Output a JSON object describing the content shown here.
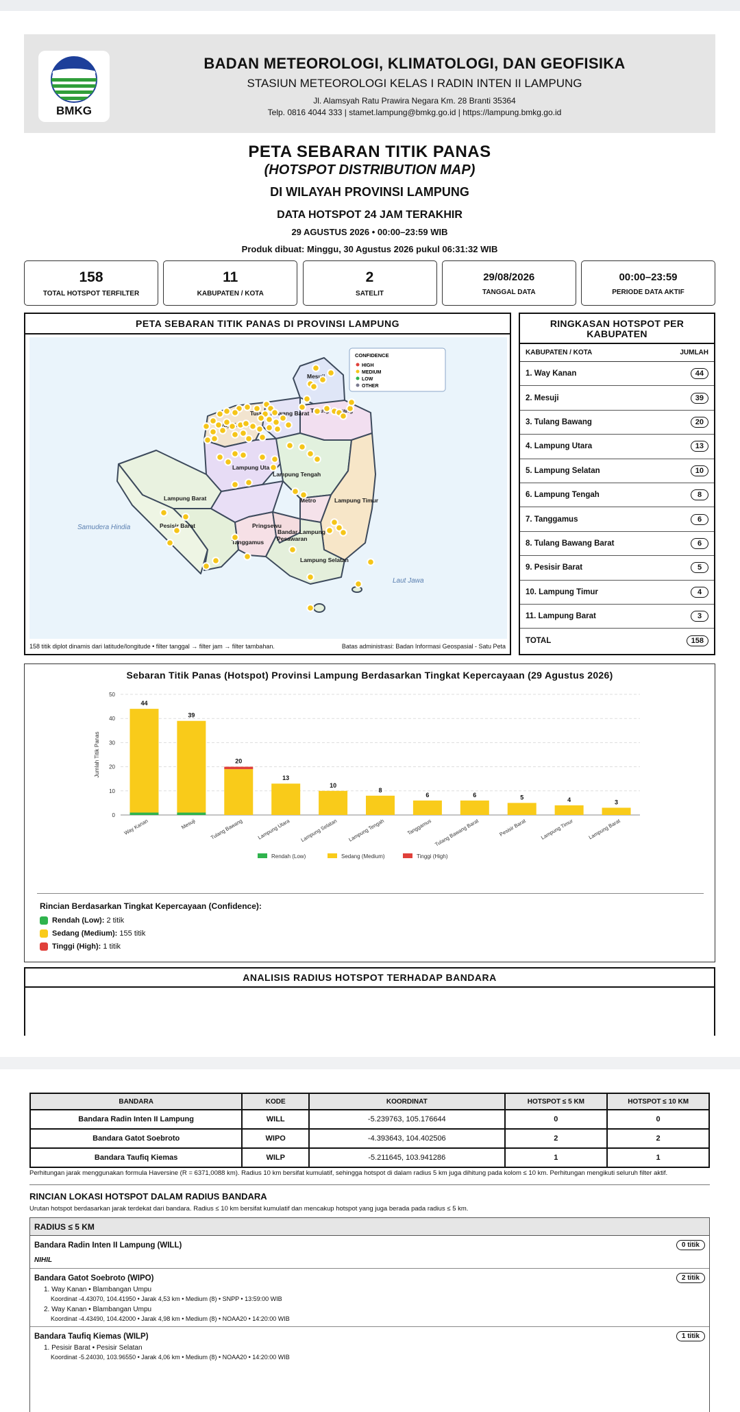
{
  "header": {
    "logo_text": "BMKG",
    "agency": "BADAN METEOROLOGI, KLIMATOLOGI, DAN GEOFISIKA",
    "station": "STASIUN METEOROLOGI KELAS I RADIN INTEN II LAMPUNG",
    "address": "Jl. Alamsyah Ratu Prawira Negara Km. 28 Branti 35364",
    "contact": "Telp. 0816 4044 333  |  stamet.lampung@bmkg.go.id  |  https://lampung.bmkg.go.id"
  },
  "title": {
    "main": "PETA SEBARAN TITIK PANAS",
    "english": "(HOTSPOT DISTRIBUTION MAP)",
    "region": "DI WILAYAH PROVINSI LAMPUNG",
    "data_label": "DATA HOTSPOT 24 JAM TERAKHIR",
    "date_range": "29 AGUSTUS 2026 • 00:00–23:59 WIB",
    "produced": "Produk dibuat: Minggu, 30 Agustus 2026 pukul 06:31:32 WIB"
  },
  "stats": [
    {
      "value": "158",
      "label": "TOTAL HOTSPOT TERFILTER"
    },
    {
      "value": "11",
      "label": "KABUPATEN / KOTA"
    },
    {
      "value": "2",
      "label": "SATELIT"
    },
    {
      "value": "29/08/2026",
      "label": "TANGGAL DATA"
    },
    {
      "value": "00:00–23:59",
      "label": "PERIODE DATA AKTIF"
    }
  ],
  "map": {
    "title": "PETA SEBARAN TITIK PANAS DI PROVINSI LAMPUNG",
    "legend": {
      "title": "CONFIDENCE",
      "items": [
        {
          "label": "HIGH",
          "color": "#e0403a"
        },
        {
          "label": "MEDIUM",
          "color": "#f5c518"
        },
        {
          "label": "LOW",
          "color": "#2fb34d"
        },
        {
          "label": "OTHER",
          "color": "#7a7a90"
        }
      ]
    },
    "labels": [
      "Mesuji",
      "Tulang Bawang Barat",
      "Tulang Bawang",
      "Way Kanan",
      "Lampung Utara",
      "Lampung Tengah",
      "Lampung Barat",
      "Metro",
      "Lampung Timur",
      "Pesisir Barat",
      "Pringsewu",
      "Bandar Lampung",
      "Pesawaran",
      "Tanggamus",
      "Lampung Selatan"
    ],
    "sea_labels": [
      "Samudera Hindia",
      "Laut Jawa"
    ],
    "footer_left": "158 titik diplot dinamis dari latitude/longitude • filter tanggal → filter jam → filter tambahan.",
    "footer_right": "Batas administrasi: Badan Informasi Geospasial - Satu Peta"
  },
  "summary": {
    "title": "RINGKASAN HOTSPOT PER KABUPATEN",
    "col_name": "KABUPATEN / KOTA",
    "col_count": "JUMLAH",
    "rows": [
      {
        "name": "1. Way Kanan",
        "count": "44"
      },
      {
        "name": "2. Mesuji",
        "count": "39"
      },
      {
        "name": "3. Tulang Bawang",
        "count": "20"
      },
      {
        "name": "4. Lampung Utara",
        "count": "13"
      },
      {
        "name": "5. Lampung Selatan",
        "count": "10"
      },
      {
        "name": "6. Lampung Tengah",
        "count": "8"
      },
      {
        "name": "7. Tanggamus",
        "count": "6"
      },
      {
        "name": "8. Tulang Bawang Barat",
        "count": "6"
      },
      {
        "name": "9. Pesisir Barat",
        "count": "5"
      },
      {
        "name": "10. Lampung Timur",
        "count": "4"
      },
      {
        "name": "11. Lampung Barat",
        "count": "3"
      }
    ],
    "total_label": "TOTAL",
    "total_value": "158"
  },
  "chart_data": {
    "type": "bar",
    "stacked": true,
    "title": "Sebaran Titik Panas (Hotspot) Provinsi Lampung Berdasarkan Tingkat Kepercayaan (29 Agustus 2026)",
    "ylabel": "Jumlah Titik Panas",
    "xlabel": "",
    "ylim": [
      0,
      50
    ],
    "yticks": [
      0,
      10,
      20,
      30,
      40,
      50
    ],
    "grid": true,
    "legend_position": "bottom",
    "categories": [
      "Way Kanan",
      "Mesuji",
      "Tulang Bawang",
      "Lampung Utara",
      "Lampung Selatan",
      "Lampung Tengah",
      "Tanggamus",
      "Tulang Bawang Barat",
      "Pesisir Barat",
      "Lampung Timur",
      "Lampung Barat"
    ],
    "series": [
      {
        "name": "Rendah (Low)",
        "color": "#2fb34d",
        "values": [
          1,
          1,
          0,
          0,
          0,
          0,
          0,
          0,
          0,
          0,
          0
        ]
      },
      {
        "name": "Sedang (Medium)",
        "color": "#f9cb1a",
        "values": [
          43,
          38,
          19,
          13,
          10,
          8,
          6,
          6,
          5,
          4,
          3
        ]
      },
      {
        "name": "Tinggi (High)",
        "color": "#e0403a",
        "values": [
          0,
          0,
          1,
          0,
          0,
          0,
          0,
          0,
          0,
          0,
          0
        ]
      }
    ],
    "totals": [
      44,
      39,
      20,
      13,
      10,
      8,
      6,
      6,
      5,
      4,
      3
    ]
  },
  "confidence": {
    "title": "Rincian Berdasarkan Tingkat Kepercayaan (Confidence):",
    "items": [
      {
        "label": "Rendah (Low):",
        "value": "2 titik",
        "color": "#2fb34d"
      },
      {
        "label": "Sedang (Medium):",
        "value": "155 titik",
        "color": "#f9cb1a"
      },
      {
        "label": "Tinggi (High):",
        "value": "1 titik",
        "color": "#e0403a"
      }
    ]
  },
  "radius": {
    "title": "ANALISIS RADIUS HOTSPOT TERHADAP BANDARA",
    "columns": [
      "BANDARA",
      "KODE",
      "KOORDINAT",
      "HOTSPOT ≤ 5 KM",
      "HOTSPOT ≤ 10 KM"
    ],
    "rows": [
      {
        "name": "Bandara Radin Inten II Lampung",
        "code": "WILL",
        "coord": "-5.239763, 105.176644",
        "r5": "0",
        "r10": "0"
      },
      {
        "name": "Bandara Gatot Soebroto",
        "code": "WIPO",
        "coord": "-4.393643, 104.402506",
        "r5": "2",
        "r10": "2"
      },
      {
        "name": "Bandara Taufiq Kiemas",
        "code": "WILP",
        "coord": "-5.211645, 103.941286",
        "r5": "1",
        "r10": "1"
      }
    ],
    "note": "Perhitungan jarak menggunakan formula Haversine (R = 6371,0088 km). Radius 10 km bersifat kumulatif, sehingga hotspot di dalam radius 5 km juga dihitung pada kolom ≤ 10 km. Perhitungan mengikuti seluruh filter aktif."
  },
  "details": {
    "title": "RINCIAN LOKASI HOTSPOT DALAM RADIUS BANDARA",
    "subtitle": "Urutan hotspot berdasarkan jarak terdekat dari bandara. Radius ≤ 10 km bersifat kumulatif dan mencakup hotspot yang juga berada pada radius ≤ 5 km.",
    "radius_head": "RADIUS ≤ 5 KM",
    "airports": [
      {
        "name": "Bandara Radin Inten II Lampung (WILL)",
        "badge": "0 titik",
        "nihil": "NIHIL",
        "items": []
      },
      {
        "name": "Bandara Gatot Soebroto (WIPO)",
        "badge": "2 titik",
        "items": [
          {
            "line1": "1. Way Kanan • Blambangan Umpu",
            "line2": "Koordinat -4.43070, 104.41950 • Jarak 4,53 km • Medium (8) • SNPP • 13:59:00 WIB"
          },
          {
            "line1": "2. Way Kanan • Blambangan Umpu",
            "line2": "Koordinat -4.43490, 104.42000 • Jarak 4,98 km • Medium (8) • NOAA20 • 14:20:00 WIB"
          }
        ]
      },
      {
        "name": "Bandara Taufiq Kiemas (WILP)",
        "badge": "1 titik",
        "items": [
          {
            "line1": "1. Pesisir Barat • Pesisir Selatan",
            "line2": "Koordinat -5.24030, 103.96550 • Jarak 4,06 km • Medium (8) • NOAA20 • 14:20:00 WIB"
          }
        ]
      }
    ]
  }
}
